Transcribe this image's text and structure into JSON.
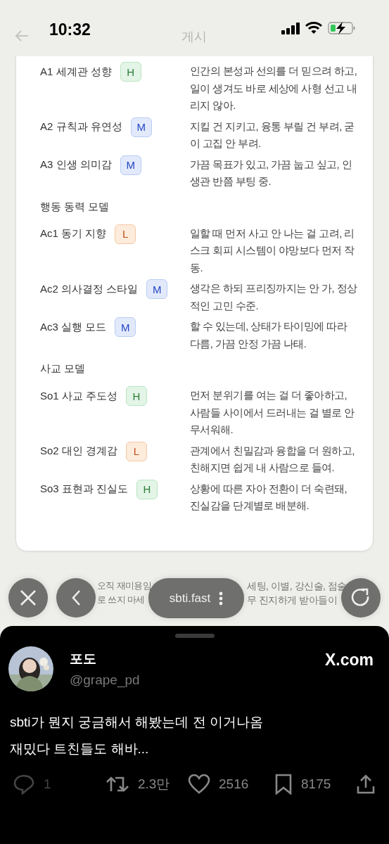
{
  "status_bar": {
    "time": "10:32"
  },
  "header": {
    "title": "게시"
  },
  "sections": [
    {
      "rows": [
        {
          "label": "A1 세계관 성향",
          "badge": {
            "text": "H",
            "kind": "high"
          },
          "description": "인간의 본성과 선의를 더 믿으려 하고, 일이 생겨도 바로 세상에 사형 선고 내리지 않아."
        },
        {
          "label": "A2 규칙과 유연성",
          "badge": {
            "text": "M",
            "kind": "medium"
          },
          "description": "지킬 건 지키고, 융통 부릴 건 부려, 굳이 고집 안 부려."
        },
        {
          "label": "A3 인생 의미감",
          "badge": {
            "text": "M",
            "kind": "medium"
          },
          "description": "가끔 목표가 있고, 가끔 눕고 싶고, 인생관 반쯤 부팅 중."
        }
      ]
    },
    {
      "title": "행동 동력 모델",
      "rows": [
        {
          "label": "Ac1 동기 지향",
          "badge": {
            "text": "L",
            "kind": "low"
          },
          "description": "일할 때 먼저 사고 안 나는 걸 고려, 리스크 회피 시스템이 야망보다 먼저 작동."
        },
        {
          "label": "Ac2 의사결정 스타일",
          "badge": {
            "text": "M",
            "kind": "medium"
          },
          "description": "생각은 하되 프리징까지는 안 가, 정상적인 고민 수준."
        },
        {
          "label": "Ac3 실행 모드",
          "badge": {
            "text": "M",
            "kind": "medium"
          },
          "description": "할 수 있는데, 상태가 타이밍에 따라 다름, 가끔 안정 가끔 나태."
        }
      ]
    },
    {
      "title": "사교 모델",
      "rows": [
        {
          "label": "So1 사교 주도성",
          "badge": {
            "text": "H",
            "kind": "high"
          },
          "description": "먼저 분위기를 여는 걸 더 좋아하고, 사람들 사이에서 드러내는 걸 별로 안 무서워해."
        },
        {
          "label": "So2 대인 경계감",
          "badge": {
            "text": "L",
            "kind": "low"
          },
          "description": "관계에서 친밀감과 융합을 더 원하고, 친해지면 쉽게 내 사람으로 들여."
        },
        {
          "label": "So3 표현과 진실도",
          "badge": {
            "text": "H",
            "kind": "high"
          },
          "description": "상황에 따른 자아 전환이 더 숙련돼, 진실감을 단계별로 배분해."
        }
      ]
    }
  ],
  "disclaimer_lines": [
    [
      "오직 재미용임",
      "세팅, 이별, 강신술, 점술"
    ],
    [
      "로 쓰지 마세",
      "무 진지하게 받아들이"
    ]
  ],
  "browser_toolbar": {
    "url": "sbti.fast"
  },
  "post": {
    "display_name": "포도",
    "handle": "@grape_pd",
    "source": "X.com",
    "text": "sbti가 뭔지 궁금해서 해봤는데 전 이거나옴\n재밌다 트친들도 해바...",
    "actions": [
      {
        "kind": "reply",
        "count": "1"
      },
      {
        "kind": "repost",
        "count": "2.3만"
      },
      {
        "kind": "like",
        "count": "2516"
      },
      {
        "kind": "bookmark",
        "count": "8175"
      },
      {
        "kind": "share"
      }
    ]
  }
}
